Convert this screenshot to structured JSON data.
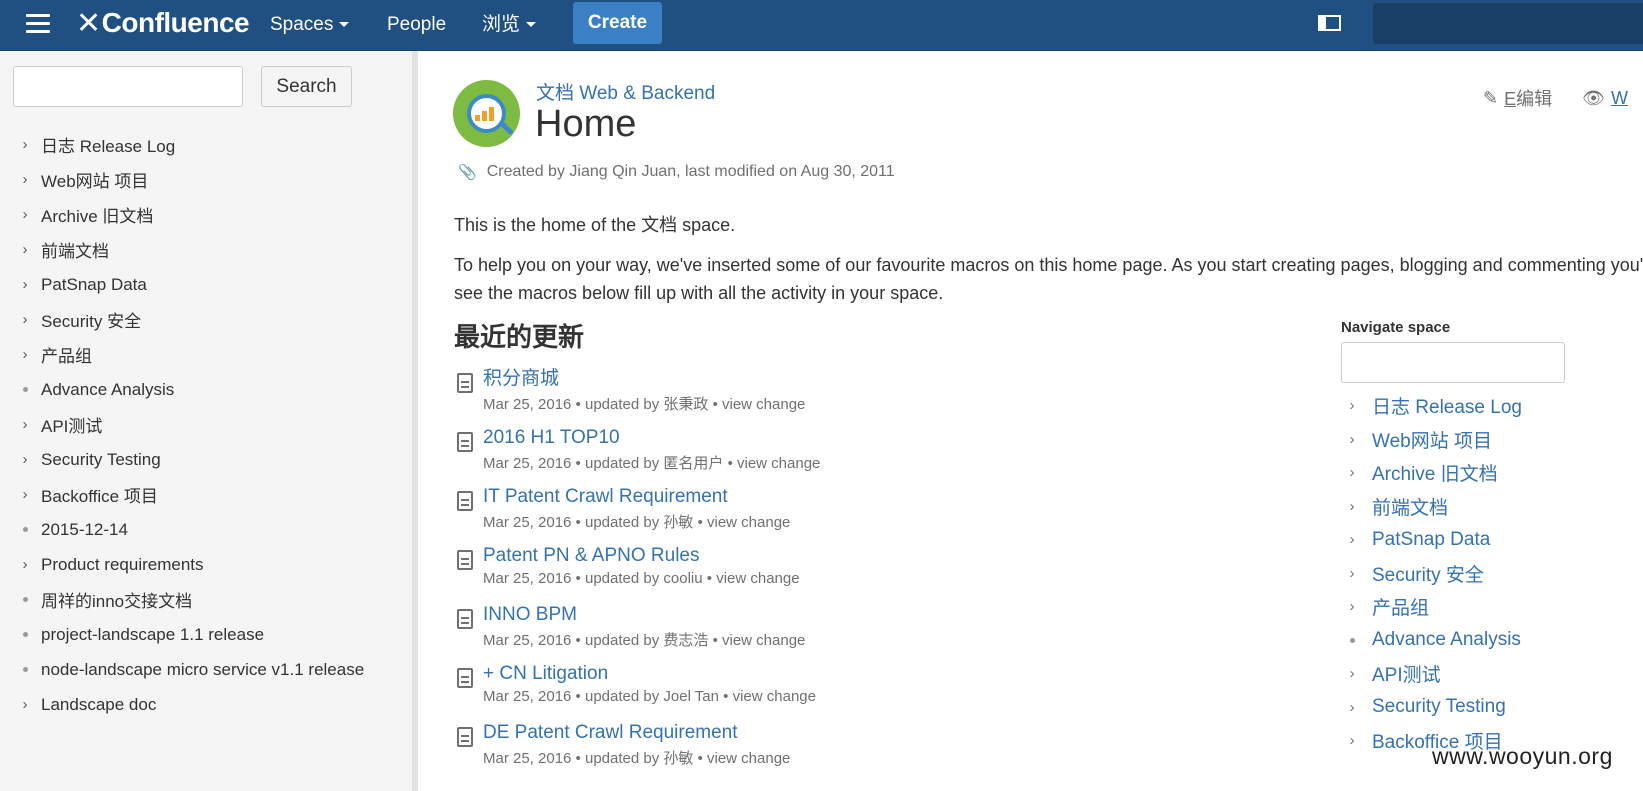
{
  "header": {
    "logo_text": "Confluence",
    "nav": {
      "spaces": "Spaces",
      "people": "People",
      "browse": "浏览"
    },
    "create_label": "Create",
    "brand_color": "#205081",
    "accent_color": "#3b7fc4"
  },
  "sidebar": {
    "search_button": "Search",
    "search_value": "",
    "tree": [
      {
        "label": "日志 Release Log",
        "icon": "chevron-right"
      },
      {
        "label": "Web网站 项目",
        "icon": "chevron-right"
      },
      {
        "label": "Archive 旧文档",
        "icon": "chevron-right"
      },
      {
        "label": "前端文档",
        "icon": "chevron-right"
      },
      {
        "label": "PatSnap Data",
        "icon": "chevron-right"
      },
      {
        "label": "Security 安全",
        "icon": "chevron-right"
      },
      {
        "label": "产品组",
        "icon": "chevron-right"
      },
      {
        "label": "Advance Analysis",
        "icon": "bullet"
      },
      {
        "label": "API测试",
        "icon": "chevron-right"
      },
      {
        "label": "Security Testing",
        "icon": "chevron-right"
      },
      {
        "label": "Backoffice 项目",
        "icon": "chevron-right"
      },
      {
        "label": "2015-12-14",
        "icon": "bullet"
      },
      {
        "label": "Product requirements",
        "icon": "chevron-right"
      },
      {
        "label": "周祥的inno交接文档",
        "icon": "bullet"
      },
      {
        "label": "project-landscape 1.1 release",
        "icon": "bullet"
      },
      {
        "label": "node-landscape micro service v1.1 release",
        "icon": "bullet"
      },
      {
        "label": "Landscape doc",
        "icon": "chevron-right"
      }
    ]
  },
  "page": {
    "breadcrumb": "文档 Web & Backend",
    "title": "Home",
    "actions": {
      "edit_key": "E",
      "edit_label": "编辑",
      "watch_key": "W"
    },
    "meta": "Created by Jiang Qin Juan, last modified on Aug 30, 2011",
    "intro": [
      "This is the home of the 文档 space.",
      "To help you on your way, we've inserted some of our favourite macros on this home page. As you start creating pages, blogging and commenting you'll see the macros below fill up with all the activity in your space."
    ],
    "recent_title": "最近的更新",
    "recent_updates": [
      {
        "title": "积分商城",
        "date": "Mar 25, 2016",
        "by": "张秉政",
        "link": "view change"
      },
      {
        "title": "2016 H1 TOP10",
        "date": "Mar 25, 2016",
        "by": "匿名用户",
        "link": "view change"
      },
      {
        "title": "IT Patent Crawl Requirement",
        "date": "Mar 25, 2016",
        "by": "孙敏",
        "link": "view change"
      },
      {
        "title": "Patent PN & APNO Rules",
        "date": "Mar 25, 2016",
        "by": "cooliu",
        "link": "view change"
      },
      {
        "title": "INNO BPM",
        "date": "Mar 25, 2016",
        "by": "费志浩",
        "link": "view change"
      },
      {
        "title": "+ CN Litigation",
        "date": "Mar 25, 2016",
        "by": "Joel Tan",
        "link": "view change"
      },
      {
        "title": "DE Patent Crawl Requirement",
        "date": "Mar 25, 2016",
        "by": "孙敏",
        "link": "view change"
      }
    ],
    "updated_by_text": "updated by",
    "navigate": {
      "label": "Navigate space",
      "items": [
        {
          "label": "日志 Release Log",
          "icon": "chevron-right"
        },
        {
          "label": "Web网站 项目",
          "icon": "chevron-right"
        },
        {
          "label": "Archive 旧文档",
          "icon": "chevron-right"
        },
        {
          "label": "前端文档",
          "icon": "chevron-right"
        },
        {
          "label": "PatSnap Data",
          "icon": "chevron-right"
        },
        {
          "label": "Security 安全",
          "icon": "chevron-right"
        },
        {
          "label": "产品组",
          "icon": "chevron-right"
        },
        {
          "label": "Advance Analysis",
          "icon": "bullet"
        },
        {
          "label": "API测试",
          "icon": "chevron-right"
        },
        {
          "label": "Security Testing",
          "icon": "chevron-right"
        },
        {
          "label": "Backoffice 项目",
          "icon": "chevron-right"
        }
      ]
    }
  },
  "watermark": "www.wooyun.org"
}
